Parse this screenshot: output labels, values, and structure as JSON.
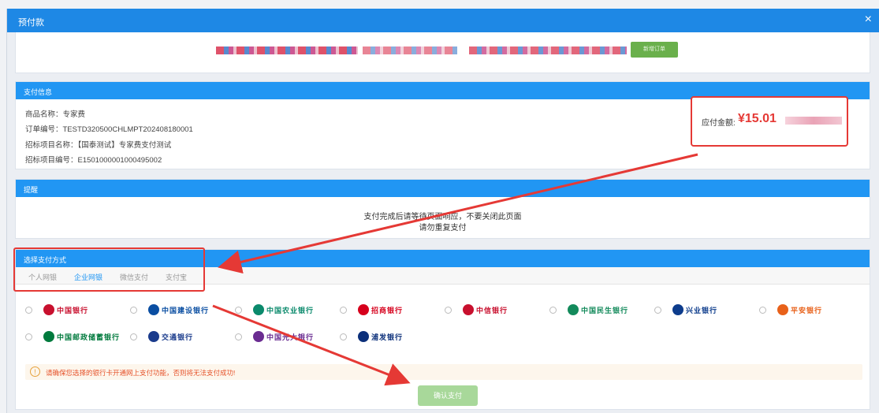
{
  "dialog": {
    "title": "预付款",
    "close_glyph": "×"
  },
  "top": {
    "button_label": "新增订单"
  },
  "payinfo": {
    "header": "支付信息",
    "product_name": "商品名称：专家费",
    "order_no": "订单编号：TESTD320500CHLMPT202408180001",
    "project_name": "招标项目名称：【国泰测试】专家费支付测试",
    "project_no": "招标项目编号：E1501000001000495002",
    "amount_label": "应付金额:",
    "amount_value": "¥15.01"
  },
  "remind": {
    "header": "提醒",
    "line1": "支付完成后请等待页面响应，不要关闭此页面",
    "line2": "请勿重复支付"
  },
  "method": {
    "header": "选择支付方式",
    "tabs": [
      "个人网银",
      "企业网银",
      "微信支付",
      "支付宝"
    ],
    "active_tab": 1,
    "banks": [
      {
        "name": "中国银行",
        "color": "#c8102e",
        "icon": "boc-logo"
      },
      {
        "name": "中国建设银行",
        "color": "#0a4ea2",
        "icon": "ccb-logo"
      },
      {
        "name": "中国农业银行",
        "color": "#0b8a6c",
        "icon": "abc-logo"
      },
      {
        "name": "招商银行",
        "color": "#d6001c",
        "icon": "cmb-logo"
      },
      {
        "name": "中信银行",
        "color": "#c8102e",
        "icon": "citic-logo"
      },
      {
        "name": "中国民生银行",
        "color": "#138a5b",
        "icon": "cmbc-logo"
      },
      {
        "name": "兴业银行",
        "color": "#0d3c8c",
        "icon": "cib-logo"
      },
      {
        "name": "平安银行",
        "color": "#e8611a",
        "icon": "pab-logo"
      },
      {
        "name": "中国邮政储蓄银行",
        "color": "#007a3d",
        "icon": "psbc-logo"
      },
      {
        "name": "交通银行",
        "color": "#1a3b8c",
        "icon": "bocom-logo"
      },
      {
        "name": "中国光大银行",
        "color": "#6a2c91",
        "icon": "ceb-logo"
      },
      {
        "name": "浦发银行",
        "color": "#0b2f7a",
        "icon": "spdb-logo"
      }
    ],
    "warning": "请确保您选择的银行卡开通网上支付功能，否则将无法支付成功!",
    "confirm_label": "确认支付"
  },
  "colors": {
    "header_blue": "#2196f3",
    "title_blue": "#1e88e5",
    "annotation_red": "#e53935",
    "confirm_green": "#a8d89a"
  }
}
